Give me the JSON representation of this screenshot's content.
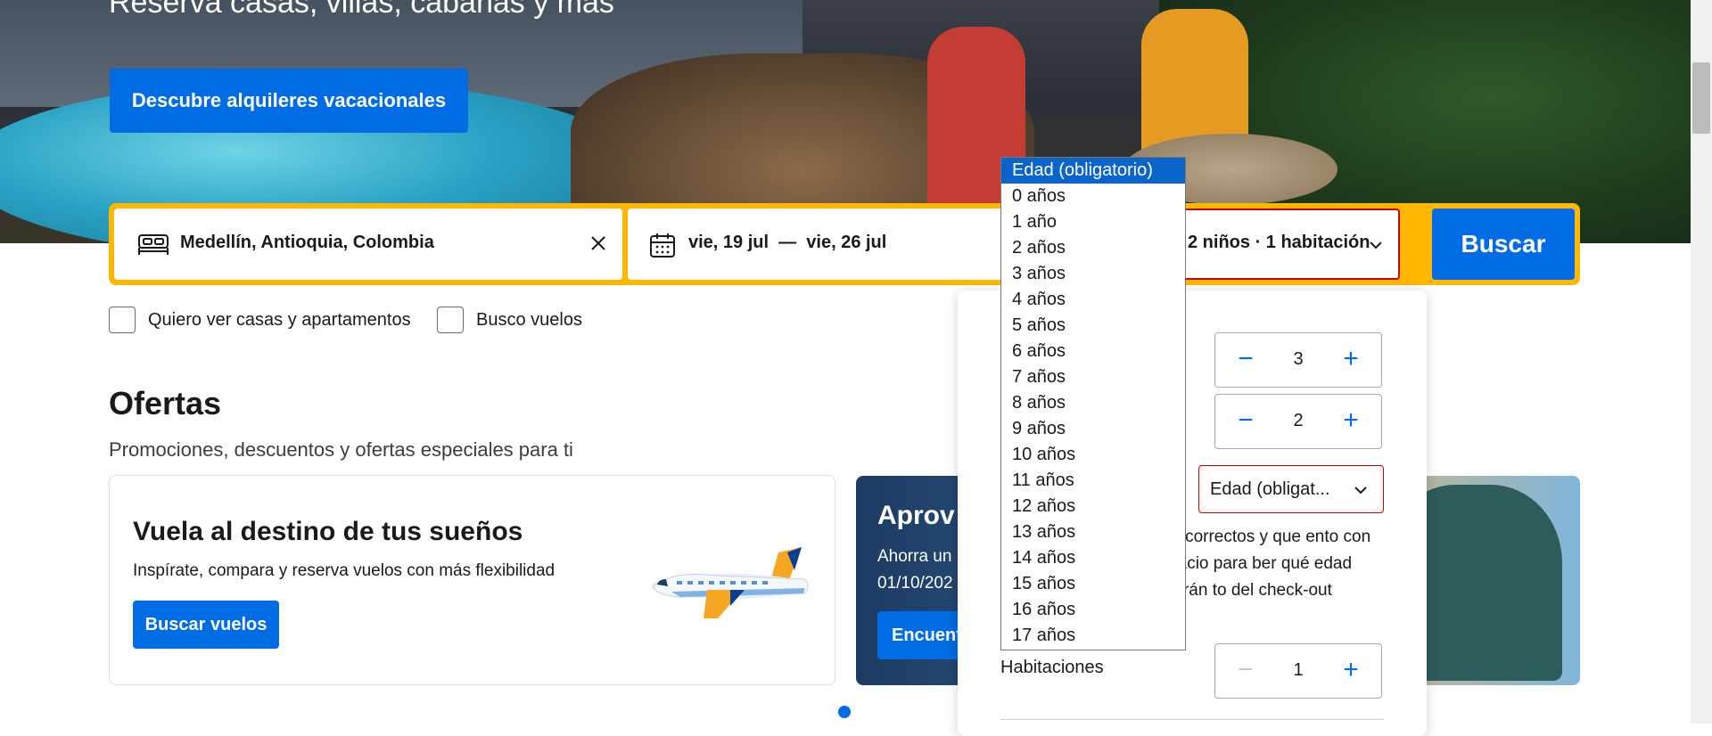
{
  "hero": {
    "title": "Reserva casas, villas, cabañas y más",
    "cta_label": "Descubre alquileres vacacionales"
  },
  "search": {
    "destination": "Medellín, Antioquia, Colombia",
    "dates": "vie, 19 jul  —  vie, 26 jul",
    "guests_summary": "2 niños · 1 habitación",
    "search_label": "Buscar",
    "icons": {
      "destination": "bed-icon",
      "clear": "close-icon",
      "dates": "calendar-icon",
      "guests": "chevron-down-icon"
    }
  },
  "options": {
    "homes_label": "Quiero ver casas y apartamentos",
    "flights_label": "Busco vuelos"
  },
  "offers": {
    "title": "Ofertas",
    "subtitle": "Promociones, descuentos y ofertas especiales para ti",
    "card1": {
      "title": "Vuela al destino de tus sueños",
      "text": "Inspírate, compara y reserva vuelos con más flexibilidad",
      "button": "Buscar vuelos"
    },
    "card2": {
      "title": "Aprov",
      "text": "Ahorra un 01/10/202",
      "button": "Encuent"
    }
  },
  "guests_popup": {
    "adults_value": "3",
    "children_value": "2",
    "age_select_value": "Edad (obligat...",
    "note": "cios correctos y que ento con espacio para ber qué edad tendrán to del check-out",
    "rooms_label": "Habitaciones",
    "rooms_value": "1"
  },
  "age_dropdown": {
    "options": [
      "Edad (obligatorio)",
      "0 años",
      "1 año",
      "2 años",
      "3 años",
      "4 años",
      "5 años",
      "6 años",
      "7 años",
      "8 años",
      "9 años",
      "10 años",
      "11 años",
      "12 años",
      "13 años",
      "14 años",
      "15 años",
      "16 años",
      "17 años"
    ],
    "selected_index": 0
  },
  "colors": {
    "accent": "#006ce4",
    "highlight": "#ffb700",
    "error": "#cc0000"
  }
}
